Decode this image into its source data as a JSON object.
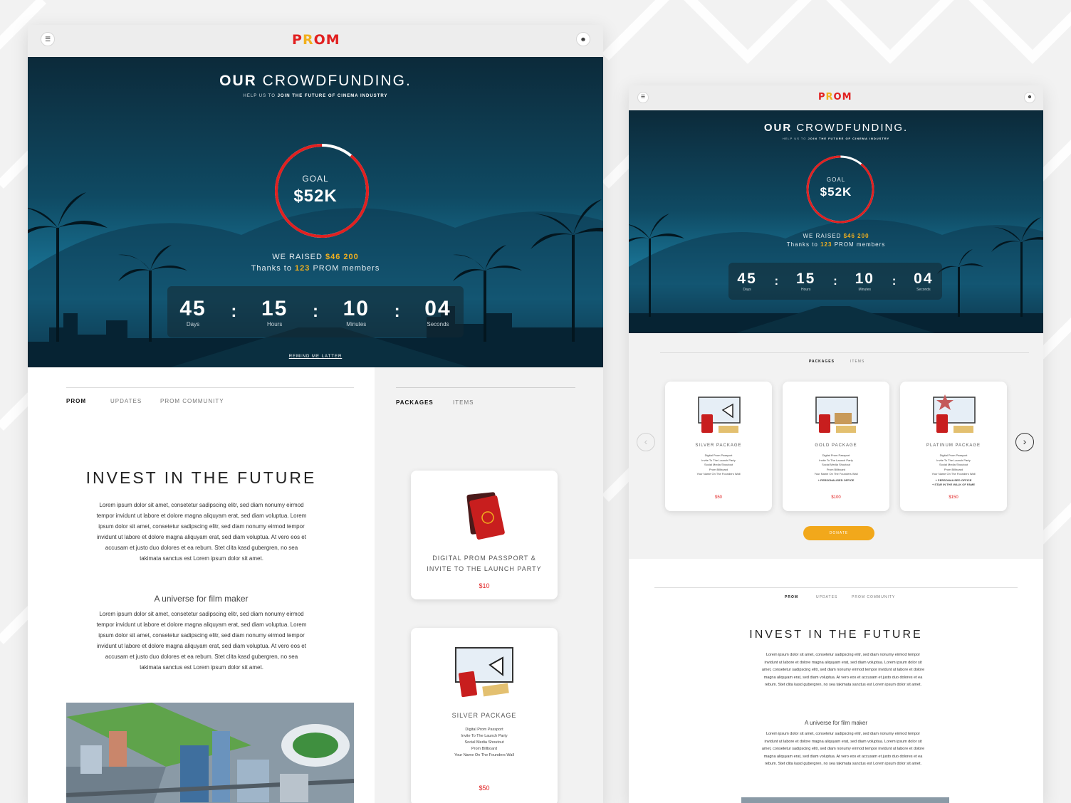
{
  "logo": [
    "P",
    "R",
    "O",
    "M"
  ],
  "colors": {
    "brand_red": "#e12020",
    "accent_yellow": "#f2b01e",
    "donate": "#f2a81b"
  },
  "icons": {
    "menu": "hamburger-icon",
    "user": "user-icon",
    "prev": "chevron-left-icon",
    "next": "chevron-right-icon"
  },
  "hero": {
    "title_bold": "OUR",
    "title_rest": "CROWDFUNDING.",
    "subtitle_prefix": "HELP US TO",
    "subtitle_bold": "JOIN THE FUTURE OF CINEMA INDUSTRY",
    "goal_label": "GOAL",
    "goal_value": "$52K",
    "goal_progress": 0.89,
    "raised_prefix": "WE RAISED",
    "raised_amount": "$46 200",
    "thanks_prefix": "Thanks to",
    "thanks_count": "123",
    "thanks_suffix": "PROM members",
    "countdown": [
      {
        "value": "45",
        "label": "Days"
      },
      {
        "value": "15",
        "label": "Hours"
      },
      {
        "value": "10",
        "label": "Minutes"
      },
      {
        "value": "04",
        "label": "Seconds"
      }
    ],
    "separator": ":",
    "remind": "REMIND ME LATTER"
  },
  "content_tabs": [
    "PROM",
    "UPDATES",
    "PROM COMMUNITY"
  ],
  "package_tabs": [
    "PACKAGES",
    "ITEMS"
  ],
  "article": {
    "heading": "INVEST IN THE FUTURE",
    "para1": "Lorem ipsum dolor sit amet, consetetur sadipscing elitr, sed diam nonumy eirmod tempor invidunt ut labore et dolore magna aliquyam erat, sed diam voluptua. Lorem ipsum dolor sit amet, consetetur sadipscing elitr, sed diam nonumy eirmod tempor invidunt ut labore et dolore magna aliquyam erat, sed diam voluptua. At vero eos et accusam et justo duo dolores et ea rebum. Stet clita kasd gubergren, no sea takimata sanctus est Lorem ipsum dolor sit amet.",
    "subheading": "A universe for film maker",
    "para2": "Lorem ipsum dolor sit amet, consetetur sadipscing elitr, sed diam nonumy eirmod tempor invidunt ut labore et dolore magna aliquyam erat, sed diam voluptua. Lorem ipsum dolor sit amet, consetetur sadipscing elitr, sed diam nonumy eirmod tempor invidunt ut labore et dolore magna aliquyam erat, sed diam voluptua. At vero eos et accusam et justo duo dolores et ea rebum. Stet clita kasd gubergren, no sea takimata sanctus est Lorem ipsum dolor sit amet."
  },
  "packages_main": [
    {
      "title": "DIGITAL PROM PASSPORT & INVITE TO THE LAUNCH PARTY",
      "lines": [],
      "price": "$10"
    },
    {
      "title": "SILVER PACKAGE",
      "lines": [
        "Digital Prom Passport",
        "Invite To The Launch Party",
        "Social Media Shoutout",
        "Prom Billboard",
        "Your Name On The Founders Wall"
      ],
      "price": "$50"
    }
  ],
  "packages_carousel": [
    {
      "title": "SILVER PACKAGE",
      "lines": [
        "Digital Prom Passport",
        "Invite To The Launch Party",
        "Social Media Shoutout",
        "Prom Billboard",
        "Your Name On The Founders Wall"
      ],
      "extras": [],
      "price": "$50"
    },
    {
      "title": "GOLD PACKAGE",
      "lines": [
        "Digital Prom Passport",
        "Invite To The Launch Party",
        "Social Media Shoutout",
        "Prom Billboard",
        "Your Name On The Founders Wall"
      ],
      "extras": [
        "+ PERSONALISED OFFICE"
      ],
      "price": "$100"
    },
    {
      "title": "PLATINUM PACKAGE",
      "lines": [
        "Digital Prom Passport",
        "Invite To The Launch Party",
        "Social Media Shoutout",
        "Prom Billboard",
        "Your Name On The Founders Wall"
      ],
      "extras": [
        "+ PERSONALISED OFFICE",
        "+ STAR IN THE WALK OF FAME"
      ],
      "price": "$150"
    }
  ],
  "donate": "DONATE"
}
